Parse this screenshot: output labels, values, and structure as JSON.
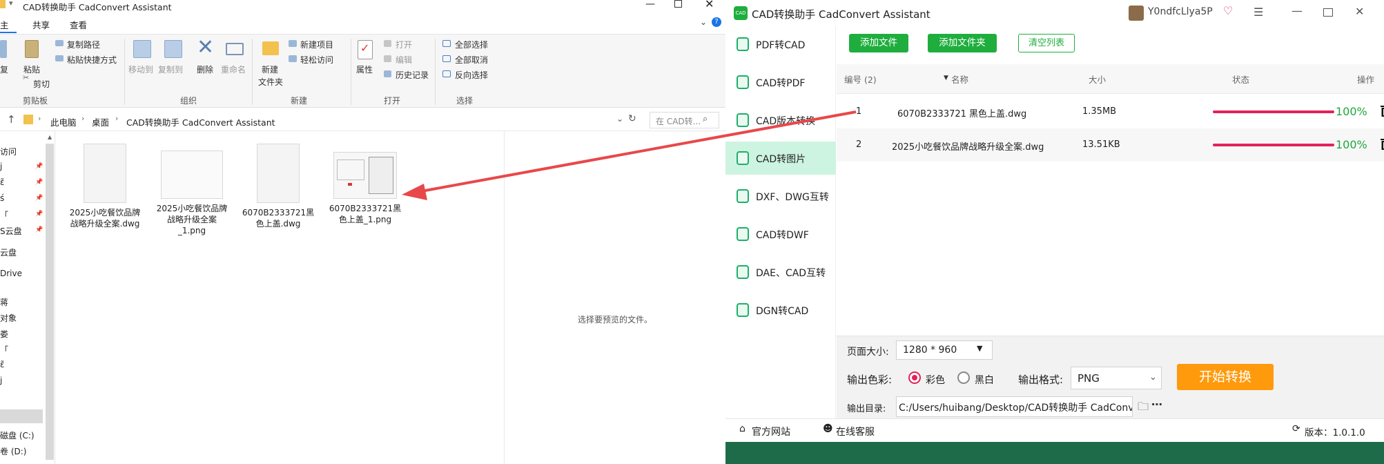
{
  "explorer": {
    "title": "CAD转换助手 CadConvert Assistant",
    "tabs": {
      "home": "主页",
      "share": "共享",
      "view": "查看"
    },
    "ribbon": {
      "copy_path": "复制路径",
      "paste_shortcut": "粘贴快捷方式",
      "copy": "复制",
      "paste": "粘贴",
      "cut": "剪切",
      "clipboard": "剪贴板",
      "move_to": "移动到",
      "copy_to": "复制到",
      "delete": "删除",
      "rename": "重命名",
      "organize": "组织",
      "new_folder_line1": "新建",
      "new_folder_line2": "文件夹",
      "new_item": "新建项目",
      "easy_access": "轻松访问",
      "new_group": "新建",
      "properties": "属性",
      "open": "打开",
      "edit": "编辑",
      "history": "历史记录",
      "open_group": "打开",
      "select_all": "全部选择",
      "select_none": "全部取消",
      "invert_select": "反向选择",
      "select_group": "选择"
    },
    "breadcrumb": [
      "此电脑",
      "桌面",
      "CAD转换助手 CadConvert Assistant"
    ],
    "search_placeholder": "在 CAD转...",
    "nav": [
      "访问",
      "j",
      "ɛ̃",
      "ś",
      "「",
      "S云盘",
      "云盘",
      "Drive",
      "蒋",
      "对象",
      "娄",
      "「",
      "ɛ̃",
      "j",
      "磁盘 (C:)",
      "卷 (D:)"
    ],
    "files": [
      {
        "name": "2025小吃餐饮品牌战略升级全案.dwg"
      },
      {
        "name": "2025小吃餐饮品牌战略升级全案_1.png"
      },
      {
        "name": "6070B2333721黑色上盖.dwg"
      },
      {
        "name": "6070B2333721黑色上盖_1.png"
      }
    ],
    "preview_text": "选择要预览的文件。"
  },
  "app": {
    "title": "CAD转换助手 CadConvert Assistant",
    "user": "Y0ndfcLlya5P",
    "sidebar": [
      "PDF转CAD",
      "CAD转PDF",
      "CAD版本转换",
      "CAD转图片",
      "DXF、DWG互转",
      "CAD转DWF",
      "DAE、CAD互转",
      "DGN转CAD"
    ],
    "active_index": 3,
    "toolbar": {
      "add_file": "添加文件",
      "add_folder": "添加文件夹",
      "clear_list": "清空列表"
    },
    "table": {
      "headers": {
        "num": "编号 (2)",
        "name": "名称",
        "size": "大小",
        "status": "状态",
        "action": "操作"
      },
      "rows": [
        {
          "num": "1",
          "name": "6070B2333721 黑色上盖.dwg",
          "size": "1.35MB",
          "progress": 1.0,
          "pct": "100%"
        },
        {
          "num": "2",
          "name": "2025小吃餐饮品牌战略升级全案.dwg",
          "size": "13.51KB",
          "progress": 1.0,
          "pct": "100%"
        }
      ]
    },
    "settings": {
      "page_size_label": "页面大小:",
      "page_size": "1280 * 960",
      "color_label": "输出色彩:",
      "color_opt": "彩色",
      "bw_opt": "黑白",
      "format_label": "输出格式:",
      "format": "PNG",
      "start": "开始转换",
      "dir_label": "输出目录:",
      "dir": "C:/Users/huibang/Desktop/CAD转换助手 CadConvert Assistant"
    },
    "footer": {
      "website": "官方网站",
      "support": "在线客服",
      "version": "版本：1.0.1.0"
    }
  },
  "colors": {
    "green": "#1fae3d",
    "pink": "#e2225a",
    "orange": "#ff9a0d",
    "arrow": "#e8484a"
  }
}
